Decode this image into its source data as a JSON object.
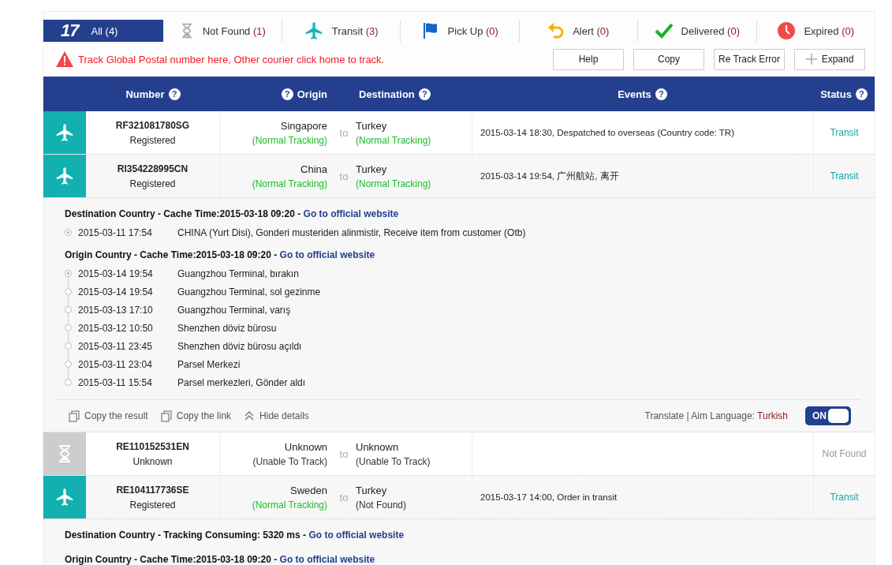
{
  "filters": [
    {
      "kind": "all",
      "logo": "17",
      "label": "All",
      "count": "(4)",
      "selected": true
    },
    {
      "kind": "notfound",
      "label": "Not Found",
      "count": "(1)",
      "selected": false
    },
    {
      "kind": "transit",
      "label": "Transit",
      "count": "(3)",
      "selected": false
    },
    {
      "kind": "pickup",
      "label": "Pick Up",
      "count": "(0)",
      "selected": false
    },
    {
      "kind": "alert",
      "label": "Alert",
      "count": "(0)",
      "selected": false
    },
    {
      "kind": "delivered",
      "label": "Delivered",
      "count": "(0)",
      "selected": false
    },
    {
      "kind": "expired",
      "label": "Expired",
      "count": "(0)",
      "selected": false
    }
  ],
  "warning": "Track Global Postal number here, Other courier click home to track.",
  "buttons": [
    {
      "kind": "plain",
      "label": "Help"
    },
    {
      "kind": "plain",
      "label": "Copy"
    },
    {
      "kind": "plain",
      "label": "Re Track Error"
    },
    {
      "kind": "expand",
      "label": "Expand"
    }
  ],
  "columns": [
    {
      "kind": "icon"
    },
    {
      "kind": "number",
      "label": "Number",
      "hint": "?"
    },
    {
      "kind": "origin",
      "label": "Origin",
      "hint": "?"
    },
    {
      "kind": "to"
    },
    {
      "kind": "destination",
      "label": "Destination",
      "hint": "?"
    },
    {
      "kind": "events",
      "label": "Events",
      "hint": "?"
    },
    {
      "kind": "status",
      "label": "Status",
      "hint": "?"
    }
  ],
  "rows": [
    {
      "kind": "transit",
      "number": "RF321081780SG",
      "type": "Registered",
      "origin": "Singapore",
      "origin_note": {
        "kind": "normal",
        "text": "(Normal Tracking)"
      },
      "to": "to",
      "destination": "Turkey",
      "destination_note": {
        "kind": "normal",
        "text": "(Normal Tracking)"
      },
      "event": "2015-03-14 18:30, Despatched to overseas (Country code: TR)",
      "status": "Transit"
    },
    {
      "kind": "transit",
      "number": "RI354228995CN",
      "type": "Registered",
      "origin": "China",
      "origin_note": {
        "kind": "normal",
        "text": "(Normal Tracking)"
      },
      "to": "to",
      "destination": "Turkey",
      "destination_note": {
        "kind": "normal",
        "text": "(Normal Tracking)"
      },
      "event": "2015-03-14 19:54, 广州航站, 离开",
      "status": "Transit",
      "details": {
        "sections": [
          {
            "heading": "Destination Country - Cache Time:2015-03-18 09:20 - ",
            "link": "Go to official website",
            "events": [
              {
                "time": "2015-03-11 17:54",
                "text": "CHINA (Yurt Disi), Gonderi musteriden alinmistir, Receive item from customer (Otb)",
                "current": true
              }
            ]
          },
          {
            "heading": "Origin Country - Cache Time:2015-03-18 09:20 - ",
            "link": "Go to official website",
            "events": [
              {
                "time": "2015-03-14 19:54",
                "text": "Guangzhou Terminal, bırakın",
                "current": true
              },
              {
                "time": "2015-03-14 19:54",
                "text": "Guangzhou Terminal, sol gezinme",
                "current": false
              },
              {
                "time": "2015-03-13 17:10",
                "text": "Guangzhou Terminal, varış",
                "current": false
              },
              {
                "time": "2015-03-12 10:50",
                "text": "Shenzhen döviz bürosu",
                "current": false
              },
              {
                "time": "2015-03-11 23:45",
                "text": "Shenzhen döviz bürosu açıldı",
                "current": false
              },
              {
                "time": "2015-03-11 23:04",
                "text": "Parsel Merkezi",
                "current": false
              },
              {
                "time": "2015-03-11 15:54",
                "text": "Parsel merkezleri, Gönder aldı",
                "current": false
              }
            ]
          }
        ],
        "footer": {
          "actions": [
            {
              "kind": "copy",
              "label": "Copy the result"
            },
            {
              "kind": "copy",
              "label": "Copy the link"
            },
            {
              "kind": "hide",
              "label": "Hide details"
            }
          ],
          "translate": "Translate | Aim Language: ",
          "language": "Turkish",
          "toggle": {
            "label": "ON",
            "on": true
          }
        }
      }
    },
    {
      "kind": "notfound",
      "number": "RE110152531EN",
      "type": "Unknown",
      "origin": "Unknown",
      "origin_note": {
        "kind": "unable",
        "text": "(Unable To Track)"
      },
      "to": "to",
      "destination": "Unknown",
      "destination_note": {
        "kind": "unable",
        "text": "(Unable To Track)"
      },
      "status": "Not Found"
    },
    {
      "kind": "transit",
      "number": "RE104117736SE",
      "type": "Registered",
      "origin": "Sweden",
      "origin_note": {
        "kind": "normal",
        "text": "(Normal Tracking)"
      },
      "to": "to",
      "destination": "Turkey",
      "destination_note": {
        "kind": "notfound",
        "text": "(Not Found)"
      },
      "event": "2015-03-17 14:00, Order in transit",
      "status": "Transit",
      "details": {
        "sections": [
          {
            "heading": "Destination Country - Tracking Consuming: 5320 ms - ",
            "link": "Go to official website"
          },
          {
            "heading": "Origin Country - Cache Time:2015-03-18 09:20 - ",
            "link": "Go to official website"
          }
        ]
      }
    }
  ]
}
